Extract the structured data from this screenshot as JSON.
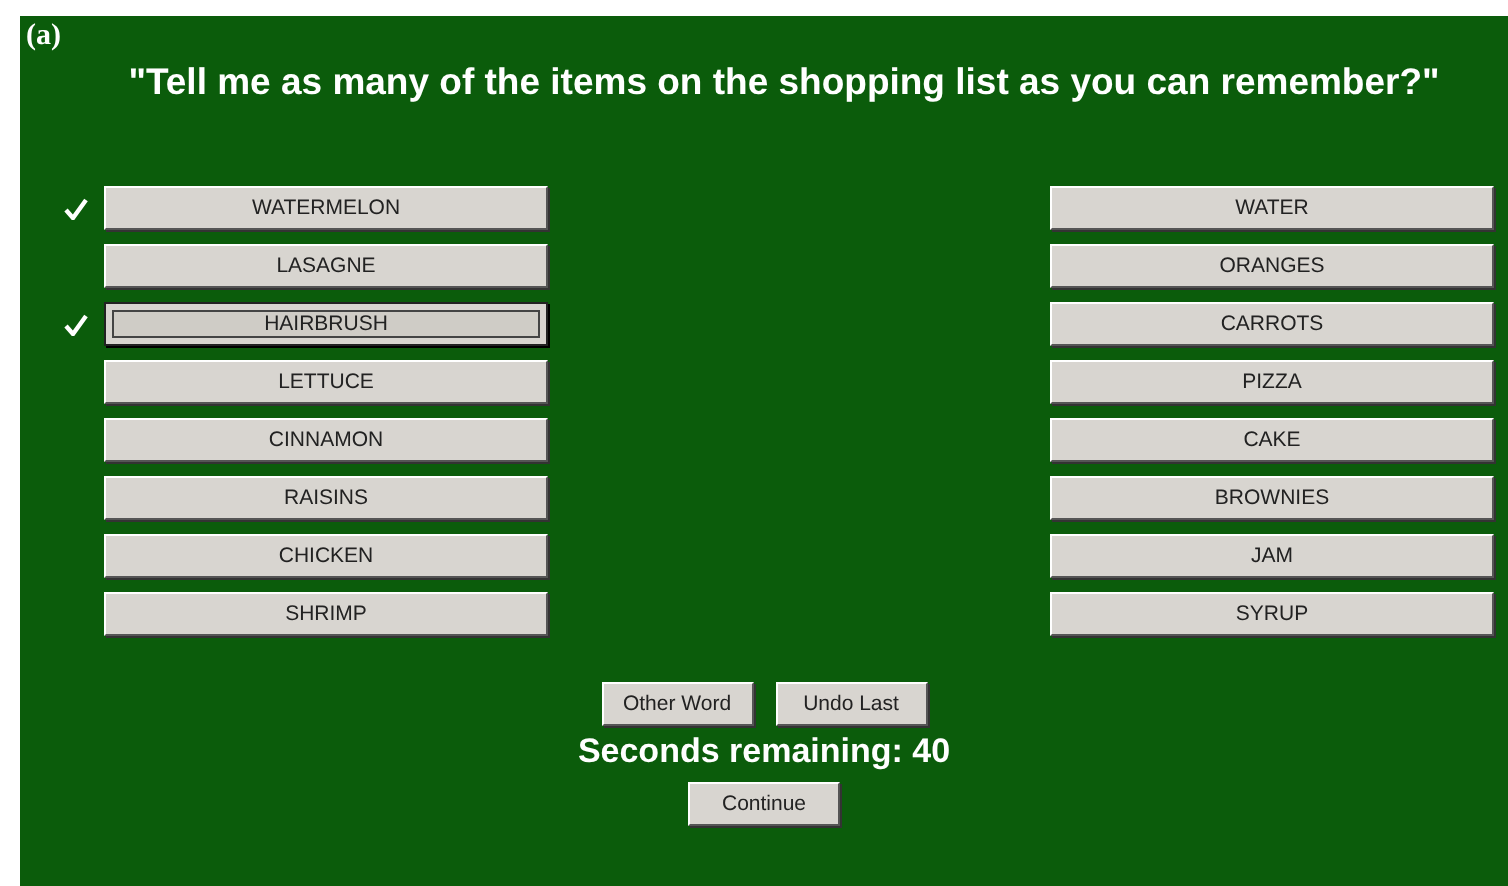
{
  "figure_label": "(a)",
  "prompt": "\"Tell me as many of the items on the shopping list as you can remember?\"",
  "left_items": [
    {
      "label": "WATERMELON",
      "checked": true,
      "focused": false
    },
    {
      "label": "LASAGNE",
      "checked": false,
      "focused": false
    },
    {
      "label": "HAIRBRUSH",
      "checked": true,
      "focused": true
    },
    {
      "label": "LETTUCE",
      "checked": false,
      "focused": false
    },
    {
      "label": "CINNAMON",
      "checked": false,
      "focused": false
    },
    {
      "label": "RAISINS",
      "checked": false,
      "focused": false
    },
    {
      "label": "CHICKEN",
      "checked": false,
      "focused": false
    },
    {
      "label": "SHRIMP",
      "checked": false,
      "focused": false
    }
  ],
  "right_items": [
    {
      "label": "WATER",
      "checked": false,
      "focused": false
    },
    {
      "label": "ORANGES",
      "checked": false,
      "focused": false
    },
    {
      "label": "CARROTS",
      "checked": false,
      "focused": false
    },
    {
      "label": "PIZZA",
      "checked": false,
      "focused": false
    },
    {
      "label": "CAKE",
      "checked": false,
      "focused": false
    },
    {
      "label": "BROWNIES",
      "checked": false,
      "focused": false
    },
    {
      "label": "JAM",
      "checked": false,
      "focused": false
    },
    {
      "label": "SYRUP",
      "checked": false,
      "focused": false
    }
  ],
  "action_buttons": [
    "Other Word",
    "Undo Last"
  ],
  "timer": "Seconds remaining: 40",
  "continue_button": "Continue"
}
